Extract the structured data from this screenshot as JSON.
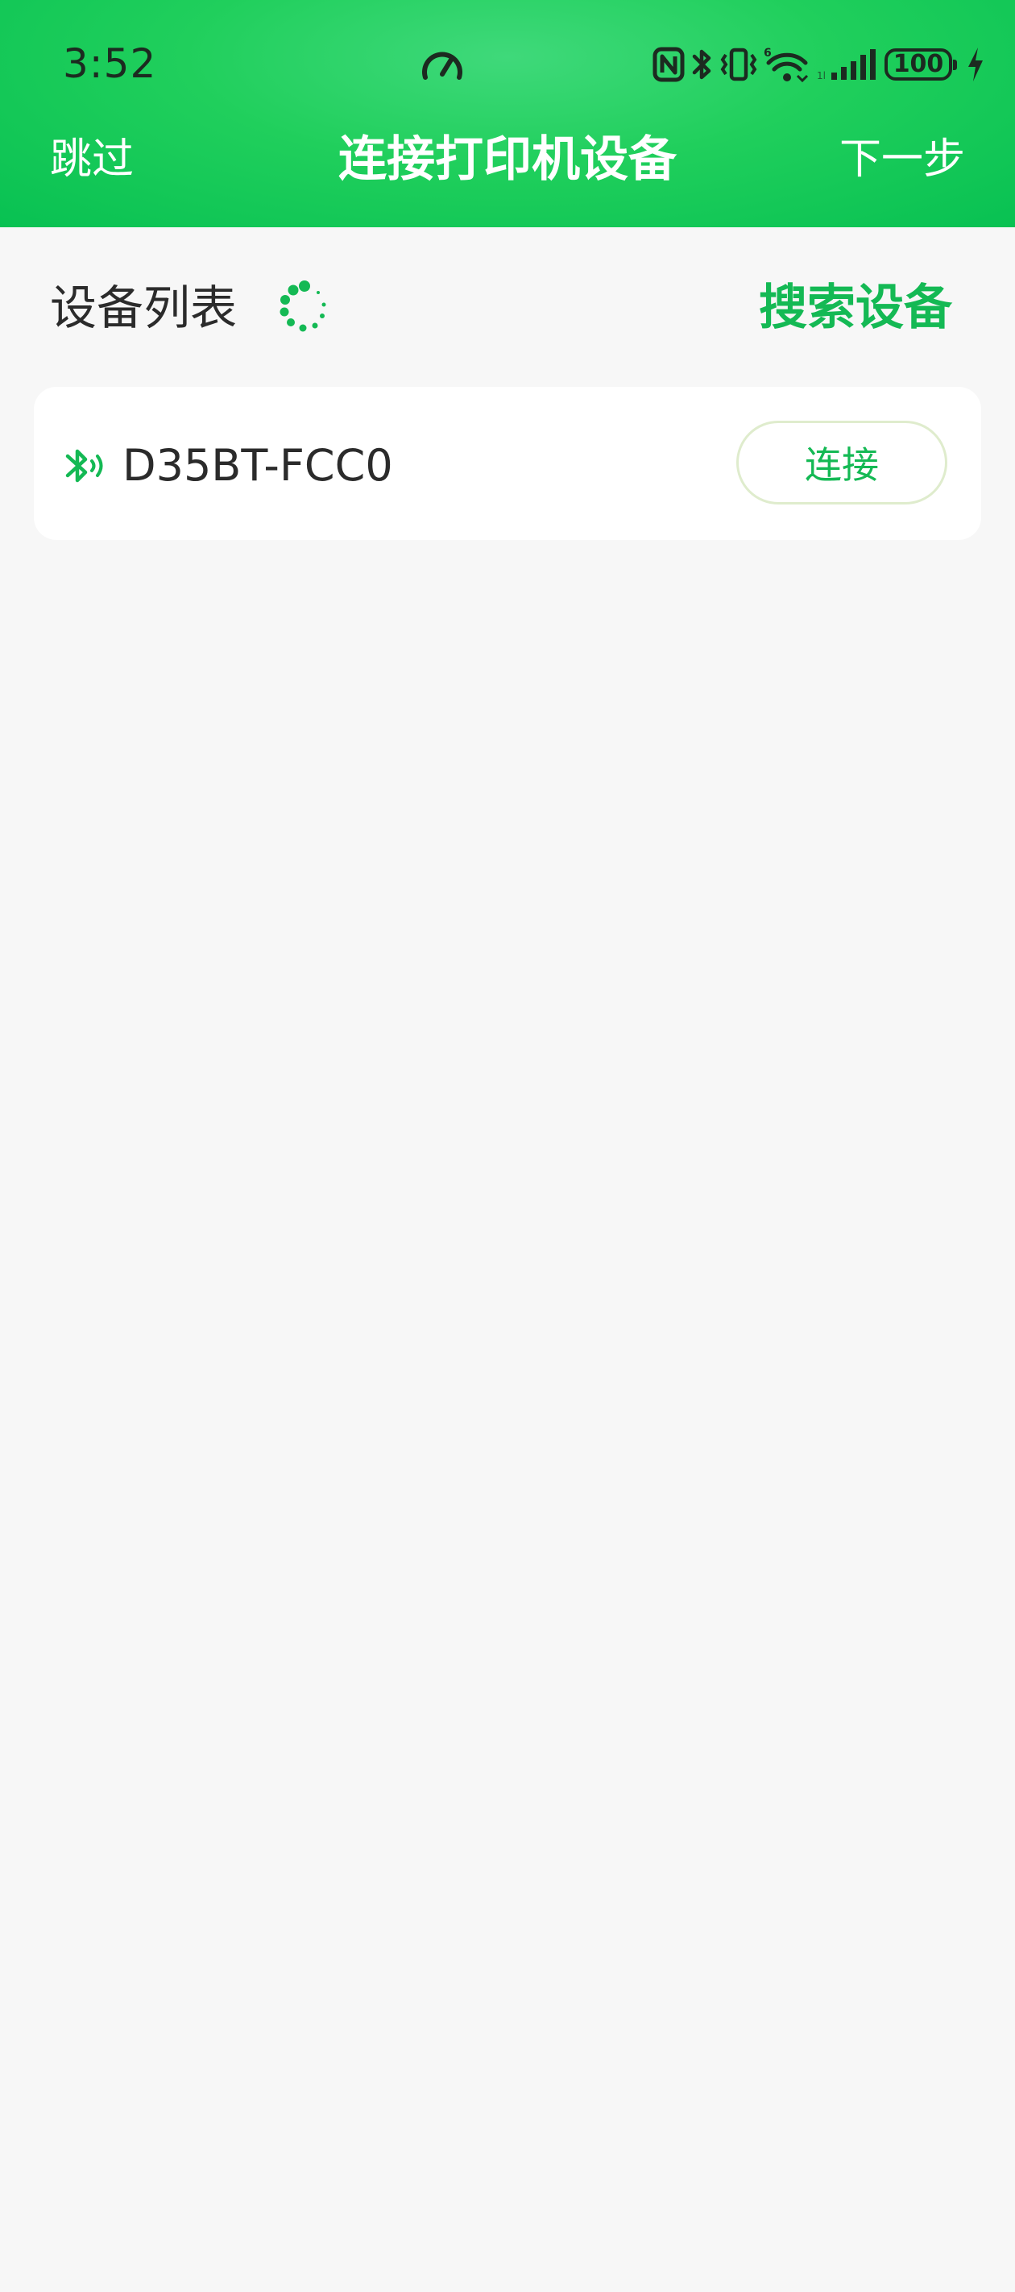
{
  "status_bar": {
    "time": "3:52",
    "battery": "100",
    "icons": [
      "speedometer-icon",
      "nfc-icon",
      "bluetooth-icon",
      "vibrate-icon",
      "wifi-icon",
      "signal-icon",
      "battery-icon",
      "charging-icon"
    ]
  },
  "nav": {
    "skip_label": "跳过",
    "title": "连接打印机设备",
    "next_label": "下一步"
  },
  "devices_section": {
    "title": "设备列表",
    "search_label": "搜索设备"
  },
  "devices": [
    {
      "name": "D35BT-FCC0",
      "connect_label": "连接"
    }
  ],
  "colors": {
    "brand_green": "#14b954",
    "header_gradient_start": "#3fd97a",
    "header_gradient_end": "#08c152",
    "background": "#f7f7f7"
  }
}
